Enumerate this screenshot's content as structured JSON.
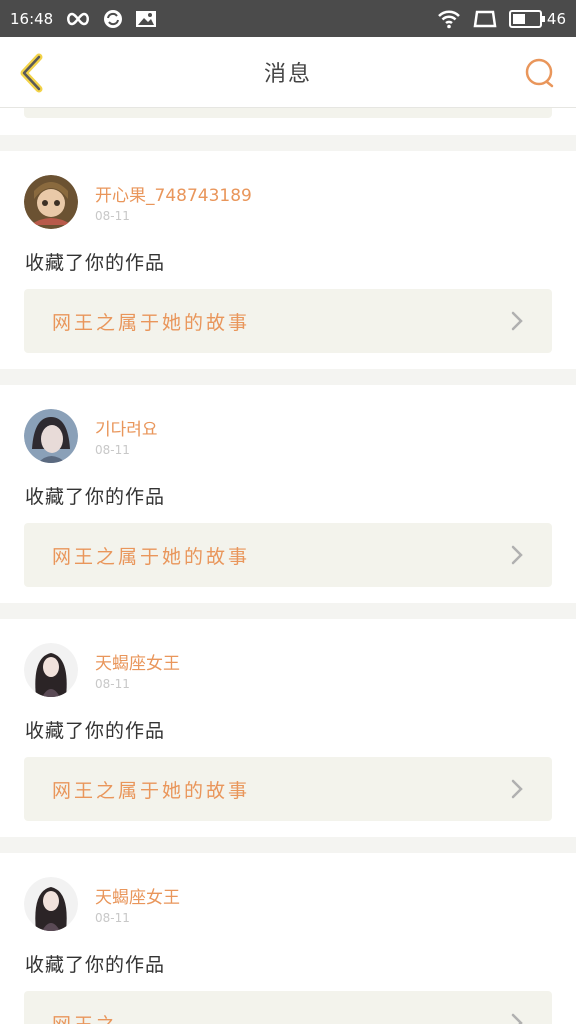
{
  "status_bar": {
    "time": "16:48",
    "battery": "46"
  },
  "header": {
    "title": "消息"
  },
  "notifications": [
    {
      "username": "开心果_748743189",
      "date": "08-11",
      "action": "收藏了你的作品",
      "work_title": "网王之属于她的故事"
    },
    {
      "username": "기다려요",
      "date": "08-11",
      "action": "收藏了你的作品",
      "work_title": "网王之属于她的故事"
    },
    {
      "username": "天蝎座女王",
      "date": "08-11",
      "action": "收藏了你的作品",
      "work_title": "网王之属于她的故事"
    },
    {
      "username": "天蝎座女王",
      "date": "08-11",
      "action": "收藏了你的作品",
      "work_title": "网王之 。 "
    }
  ],
  "colors": {
    "accent": "#e9965b",
    "link_bg": "#f3f3ec",
    "status_bar": "#4b4b4b"
  }
}
